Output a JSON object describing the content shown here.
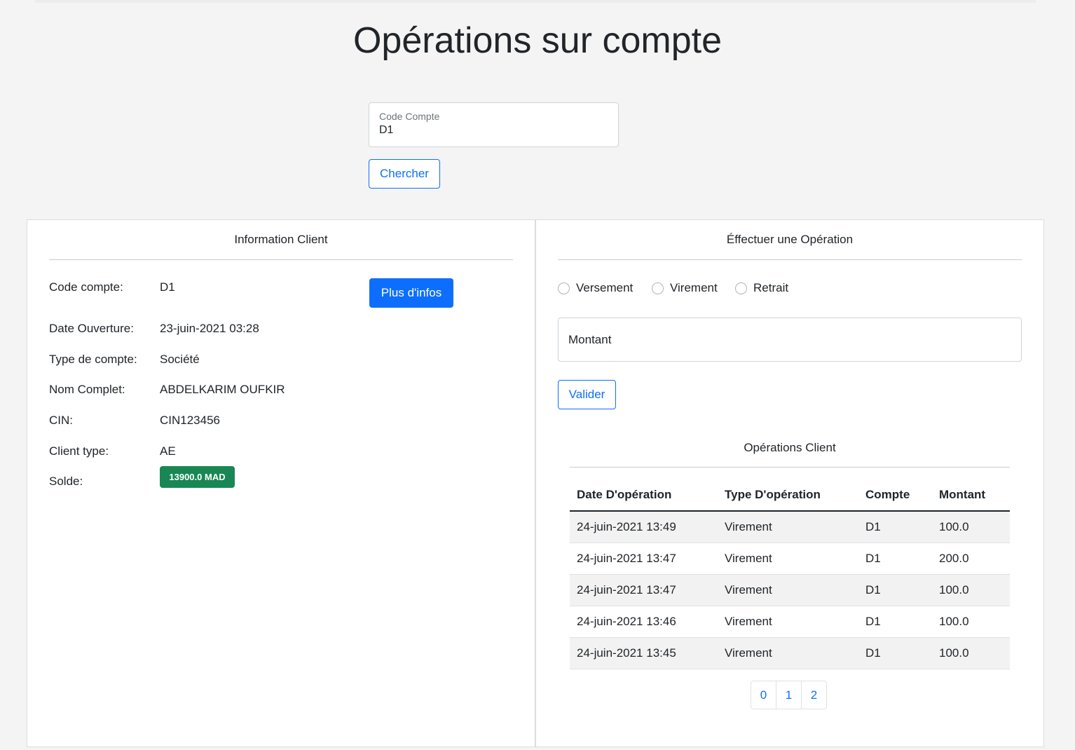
{
  "page": {
    "title": "Opérations sur compte"
  },
  "search": {
    "label": "Code Compte",
    "value": "D1",
    "button_label": "Chercher"
  },
  "client_panel": {
    "title": "Information Client",
    "more_button": "Plus d'infos",
    "rows": {
      "code_compte": {
        "label": "Code compte:",
        "value": "D1"
      },
      "date_ouverture": {
        "label": "Date Ouverture:",
        "value": "23-juin-2021 03:28"
      },
      "type_compte": {
        "label": "Type de compte:",
        "value": "Société"
      },
      "nom_complet": {
        "label": "Nom Complet:",
        "value": "ABDELKARIM OUFKIR"
      },
      "cin": {
        "label": "CIN:",
        "value": "CIN123456"
      },
      "client_type": {
        "label": "Client type:",
        "value": "AE"
      },
      "solde": {
        "label": "Solde:",
        "value": "13900.0 MAD"
      }
    }
  },
  "operation_panel": {
    "title": "Éffectuer une Opération",
    "radios": [
      "Versement",
      "Virement",
      "Retrait"
    ],
    "amount_placeholder": "Montant",
    "submit_label": "Valider",
    "history": {
      "title": "Opérations Client",
      "columns": [
        "Date D'opération",
        "Type D'opération",
        "Compte",
        "Montant"
      ],
      "rows": [
        [
          "24-juin-2021 13:49",
          "Virement",
          "D1",
          "100.0"
        ],
        [
          "24-juin-2021 13:47",
          "Virement",
          "D1",
          "200.0"
        ],
        [
          "24-juin-2021 13:47",
          "Virement",
          "D1",
          "100.0"
        ],
        [
          "24-juin-2021 13:46",
          "Virement",
          "D1",
          "100.0"
        ],
        [
          "24-juin-2021 13:45",
          "Virement",
          "D1",
          "100.0"
        ]
      ],
      "pages": [
        "0",
        "1",
        "2"
      ]
    }
  },
  "colors": {
    "primary": "#0d6efd",
    "success": "#198754",
    "background": "#f4f4f4"
  }
}
